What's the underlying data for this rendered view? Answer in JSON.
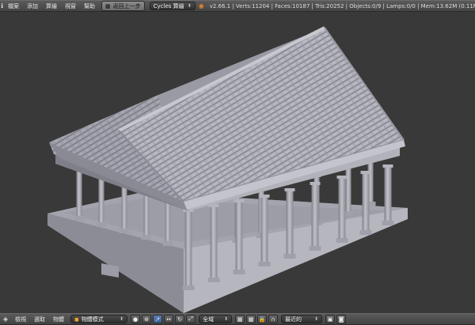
{
  "top_bar": {
    "editor_icon": "info-editor-icon",
    "menus": [
      "檔案",
      "添加",
      "算繪",
      "視窗",
      "幫助"
    ],
    "layout_icon": "screen-layout-icon",
    "undo_label": "返回上一步",
    "engine_label": "Cycles 算繪",
    "blender_icon": "blender-logo-icon",
    "stats": "v2.66.1 | Verts:11204 | Faces:10187 | Tris:20252 | Objects:0/9 | Lamps:0/0 | Mem:13.62M (0.11M) | C"
  },
  "bottom_bar": {
    "editor_icon": "3d-view-editor-icon",
    "menus": [
      "檢視",
      "選取",
      "物體"
    ],
    "mode_label": "物體模式",
    "pivot_label": "全域",
    "snap_label": "最近的",
    "icons": [
      "shading-solid-icon",
      "pivot-point-icon",
      "manipulator-icon",
      "translate-icon",
      "rotate-icon",
      "scale-icon",
      "orientation-icon",
      "layer-icon",
      "lock-icon",
      "snap-magnet-icon",
      "render-icon",
      "camera-icon"
    ]
  },
  "viewport": {
    "object": "temple-model"
  },
  "colors": {
    "background": "#393939",
    "model": "#a6a6b0",
    "accent": "#5b7fb8"
  }
}
